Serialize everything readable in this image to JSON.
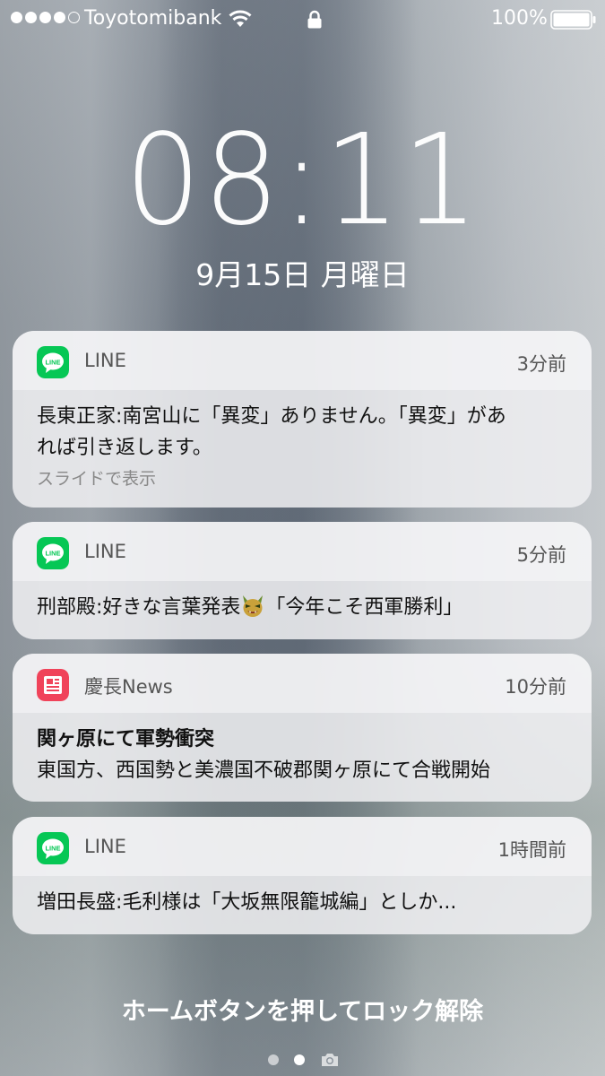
{
  "status_bar": {
    "carrier": "Toyotomibank",
    "battery_percent": "100%",
    "signal_bars_filled": 4,
    "signal_bars_total": 5
  },
  "lock_screen": {
    "time": "08:11",
    "date": "9月15日 月曜日",
    "unlock_hint": "ホームボタンを押してロック解除",
    "page_dots": [
      "dot",
      "dot-active",
      "camera-icon"
    ]
  },
  "notifications": [
    {
      "app": "LINE",
      "icon": "line-app-icon",
      "time": "3分前",
      "lines": [
        "長東正家:南宮山に「異変」ありません。「異変」があ",
        "れば引き返します。"
      ],
      "hint": "スライドで表示"
    },
    {
      "app": "LINE",
      "icon": "line-app-icon",
      "time": "5分前",
      "text_before": "刑部殿:好きな言葉発表",
      "emoji": "demon-face-emoji",
      "text_after": "「今年こそ西軍勝利」"
    },
    {
      "app": "慶長News",
      "icon": "news-app-icon",
      "time": "10分前",
      "title": "関ヶ原にて軍勢衝突",
      "text": "東国方、西国勢と美濃国不破郡関ヶ原にて合戦開始"
    },
    {
      "app": "LINE",
      "icon": "line-app-icon",
      "time": "1時間前",
      "text": "増田長盛:毛利様は「大坂無限籠城編」としか..."
    }
  ],
  "colors": {
    "line_green": "#06C755",
    "news_red": "#F0435A",
    "card_bg": "#F0F0F2"
  }
}
